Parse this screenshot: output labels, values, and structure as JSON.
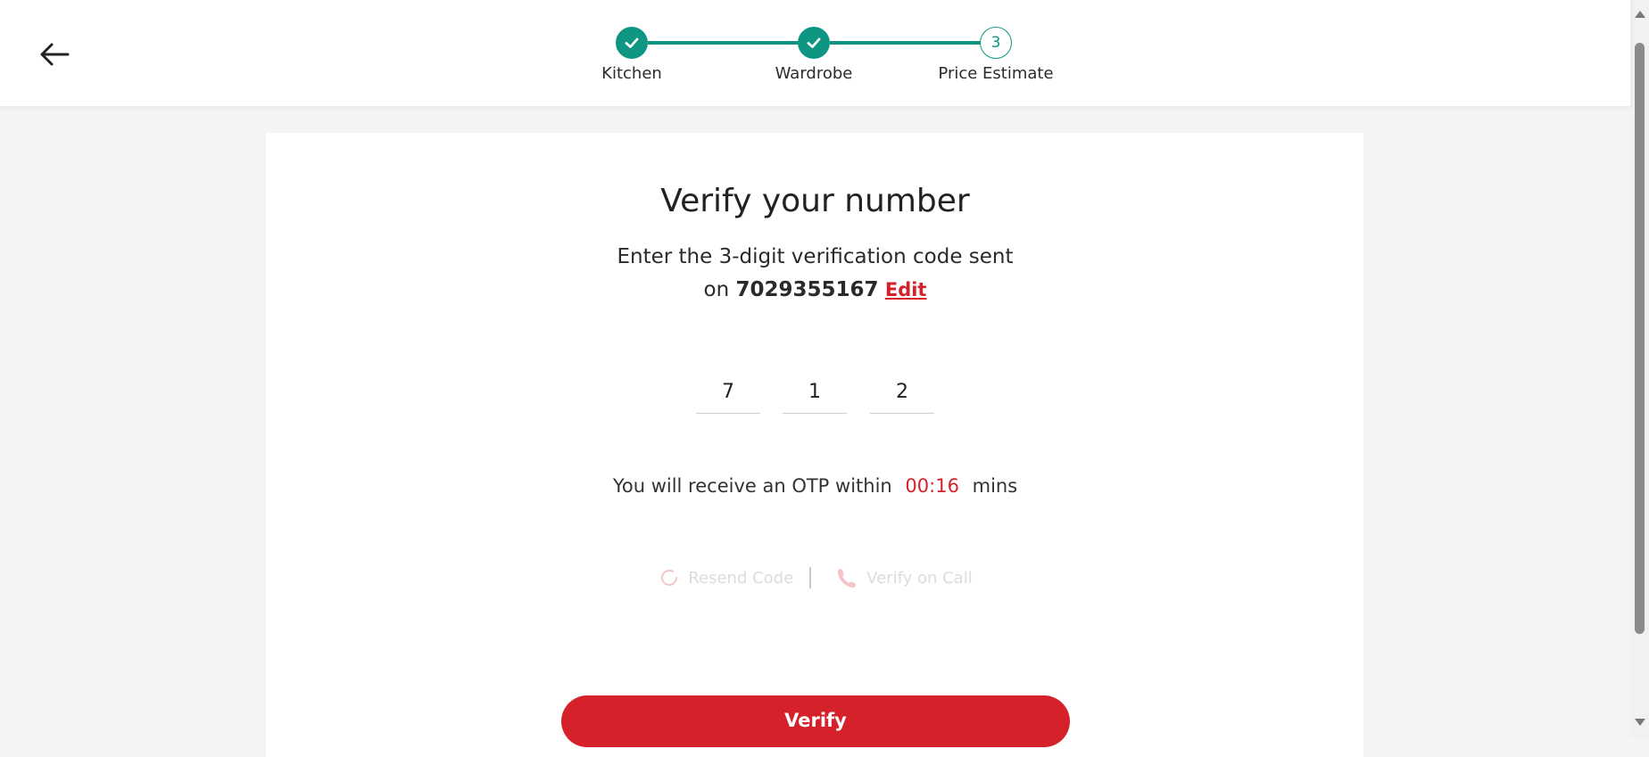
{
  "stepper": {
    "steps": [
      {
        "label": "Kitchen",
        "state": "done"
      },
      {
        "label": "Wardrobe",
        "state": "done"
      },
      {
        "label": "Price Estimate",
        "state": "current",
        "number": "3"
      }
    ]
  },
  "verify": {
    "title": "Verify your number",
    "subtitle_line1": "Enter the 3-digit verification code sent",
    "subtitle_on": "on",
    "phone": "7029355167",
    "edit_label": "Edit",
    "otp_digits": [
      "7",
      "1",
      "2"
    ],
    "otp_note_prefix": "You will receive an OTP within",
    "timer": "00:16",
    "otp_note_suffix": "mins",
    "resend_label": "Resend Code",
    "call_label": "Verify on Call",
    "button_label": "Verify"
  },
  "colors": {
    "accent_green": "#0e9682",
    "accent_red": "#d52129"
  },
  "icons": {
    "back": "arrow-left-icon",
    "check": "check-icon",
    "resend": "refresh-icon",
    "call": "phone-icon"
  }
}
